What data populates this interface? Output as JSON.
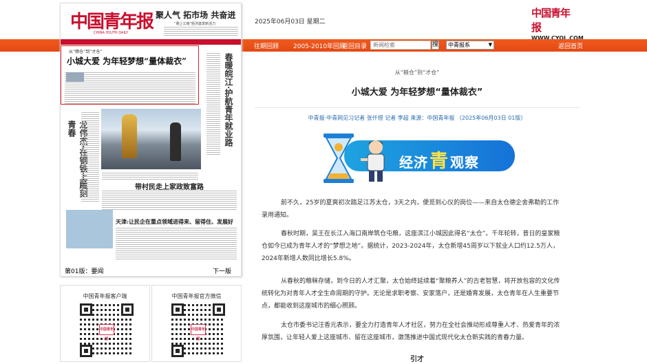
{
  "header": {
    "date": "2025年06月03日 星期二",
    "logo_text": "中国青年报",
    "logo_url": "WWW.CYOL.COM"
  },
  "nav": {
    "back_to_date": "往期回顾",
    "past_years": "2005-2010年回顾",
    "back_to_index": "返回目录",
    "search_placeholder": "新闻检索",
    "search_button": "搜",
    "paper_select": "中青报系",
    "back_to_home": "返回首页"
  },
  "paper": {
    "masthead": "中国青年报",
    "masthead_sub": "CHINA YOUTH DAILY",
    "headline1": "聚人气  拓市场  共奋进",
    "headline1_sub": "“赛上江南”经济激发新活力",
    "highlight_kicker": "从“粮仓”到“才仓”",
    "highlight_title": "小城大爱  为年轻梦想“量体裁衣”",
    "side_title_right": "春暖皖江·护航青年就业路",
    "side_title_left": "龙伟杰·在钢铁上雕刻青春",
    "sub_head_1": "带村民走上家政致富路",
    "sub_head_2": "天津:让民企在重点领域进得来、留得住、发展好",
    "page_label": "第01版：要闻",
    "next_label": "下一版"
  },
  "qr": {
    "app_title": "中国青年报客户端",
    "wechat_title": "中国青年报官方微信",
    "center_label": "中国青年报"
  },
  "article": {
    "kicker": "从“粮仓”到“才仓”",
    "title": "小城大爱  为年轻梦想“量体裁衣”",
    "byline": "中青报·中青网见习记者 张仟煜 记者 李超    来源：中国青年报    （2025年06月03日  01版）",
    "banner_pre": "经济",
    "banner_big": "青",
    "banner_post": "观察",
    "paragraphs": [
      "前不久，25岁的夏爽初次踏足江苏太仓，3天之内，便觅到心仪的岗位——来自太仓德企舍弗勒的工作录用通知。",
      "春秋时期，吴王在长江入海口南岸筑仓屯粮，这座滨江小城因此得名“太仓”。千年轮转，昔日的皇家粮仓如今已成为青年人才的“梦想之地”。据统计，2023-2024年，太仓新增45周岁以下就业人口约12.5万人，2024年新增人数同比增长5.8%。",
      "从春秋的粮秣存储，到今日的人才汇聚，太仓始终延续着“聚粮养人”的古老智慧，将开放包容的文化传统转化为对青年人才全生命周期的守护。无论是求职考察、安家落户，还是婚育发展，太仓青年在人生重要节点，都能收到这座城市的细心照顾。",
      "太仓市委书记汪香元表示，要全力打造青年人才社区，努力在全社会推动形成尊重人才、热爱青年的浓厚氛围，让年轻人爱上这座城市、留在这座城市，激荡推进中国式现代化太仓新实践的青春力量。"
    ],
    "section_end": "引才"
  }
}
